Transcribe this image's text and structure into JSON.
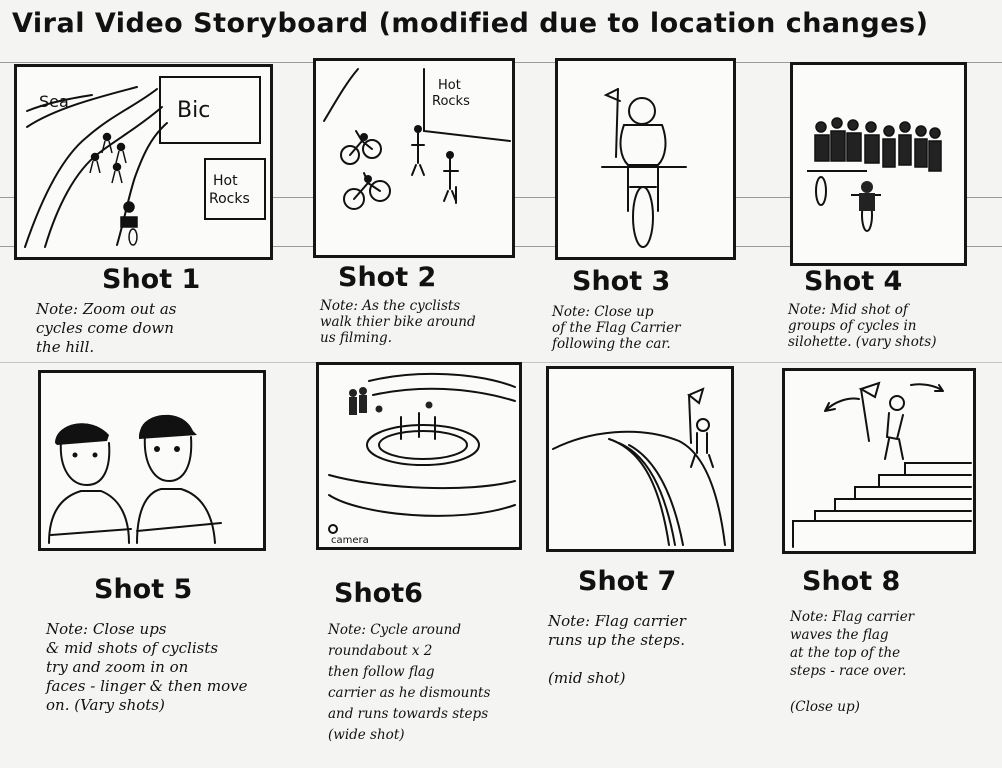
{
  "storyboard": {
    "title": "Viral Video Storyboard (modified due to location changes)",
    "shots": [
      {
        "label": "Shot 1",
        "note": "Note: Zoom out as\ncycles come down\nthe hill.",
        "labels": [
          "Sea",
          "Bic",
          "Hot\nRocks"
        ]
      },
      {
        "label": "Shot 2",
        "note": "Note: As the cyclists\nwalk thier bike around\nus filming.",
        "labels": [
          "Hot\nRocks"
        ]
      },
      {
        "label": "Shot 3",
        "note": "Note: Close up\nof the Flag Carrier\nfollowing the car.",
        "labels": []
      },
      {
        "label": "Shot 4",
        "note": "Note: Mid shot of\ngroups of cycles in\nsilohette. (vary shots)",
        "labels": []
      },
      {
        "label": "Shot 5",
        "note": "Note: Close ups\n& mid shots of cyclists\ntry and zoom in on\nfaces - linger & then move\non. (Vary shots)",
        "labels": []
      },
      {
        "label": "Shot6",
        "note": "Note: Cycle around\nroundabout x 2\nthen follow flag\ncarrier as he dismounts\nand runs towards steps\n(wide shot)",
        "labels": [
          "camera"
        ]
      },
      {
        "label": "Shot 7",
        "note": "Note: Flag carrier\nruns up the steps.\n\n(mid shot)",
        "labels": []
      },
      {
        "label": "Shot 8",
        "note": "Note: Flag carrier\nwaves the flag\nat the top of the\nsteps - race over.\n\n(Close up)",
        "labels": []
      }
    ]
  }
}
